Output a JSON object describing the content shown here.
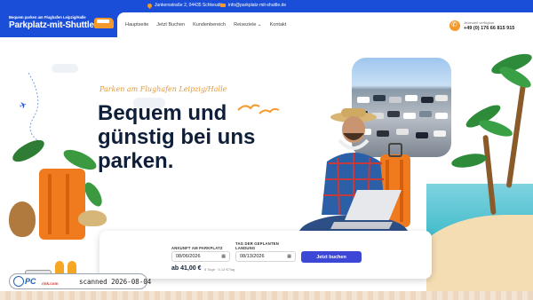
{
  "topbar": {
    "address": "Junkersstraße 2, 04435 Schkeuditz",
    "email": "info@parkplatz-mit-shuttle.de"
  },
  "logo": {
    "small_text": "Bequem parken am Flughafen Leipzig/Halle",
    "main_text": "Parkplatz-mit-Shuttle.de"
  },
  "nav": {
    "items": [
      "Hauptseite",
      "Jetzt Buchen",
      "Kundenbereich",
      "Reiseziele ⌄",
      "Kontakt"
    ]
  },
  "contact": {
    "label": "Jederzeit verfügbar",
    "phone": "+49 (0) 176 66 815 915"
  },
  "hero": {
    "subtitle": "Parken am Flughafen Leipzig/Halle",
    "headline": "Bequem und günstig bei uns parken."
  },
  "booking": {
    "arrival_label": "ANKUNFT AM PARKPLATZ",
    "arrival_value": "08/06/2026",
    "departure_label": "TAG DER GEPLANTEN LANDUNG",
    "departure_value": "08/13/2026",
    "button_label": "Jetzt buchen",
    "price": "ab 41,00 €",
    "price_note": "8 Tage · 5,13 €/Tag"
  },
  "watermark": {
    "brand": "PC",
    "brand_suffix": "risk.com",
    "text": "scanned 2026-08-04"
  },
  "colors": {
    "primary_blue": "#1a4ed8",
    "accent_orange": "#f59a2a",
    "button_indigo": "#3d47d6",
    "headline_navy": "#0f1f3a"
  }
}
